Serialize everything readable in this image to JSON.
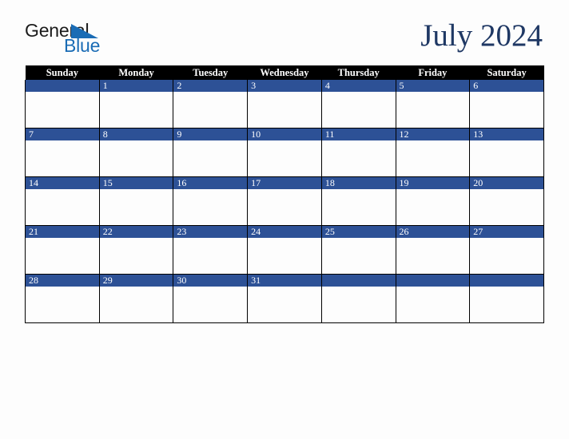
{
  "brand": {
    "name_part1": "General",
    "name_part2": "Blue",
    "triangle_color": "#1a6cb5",
    "text_color_part1": "#1c1c1c",
    "text_color_part2": "#1a6cb5"
  },
  "header": {
    "title": "July 2024",
    "title_color": "#1f3864"
  },
  "calendar": {
    "header_background": "#000000",
    "header_text_color": "#ffffff",
    "day_band_color": "#2d5196",
    "day_number_color": "#ffffff",
    "cell_background": "#fdfdfd",
    "grid_line_color": "#000000",
    "weekday_headers": [
      "Sunday",
      "Monday",
      "Tuesday",
      "Wednesday",
      "Thursday",
      "Friday",
      "Saturday"
    ],
    "weeks": [
      [
        "",
        "1",
        "2",
        "3",
        "4",
        "5",
        "6"
      ],
      [
        "7",
        "8",
        "9",
        "10",
        "11",
        "12",
        "13"
      ],
      [
        "14",
        "15",
        "16",
        "17",
        "18",
        "19",
        "20"
      ],
      [
        "21",
        "22",
        "23",
        "24",
        "25",
        "26",
        "27"
      ],
      [
        "28",
        "29",
        "30",
        "31",
        "",
        "",
        ""
      ]
    ]
  }
}
